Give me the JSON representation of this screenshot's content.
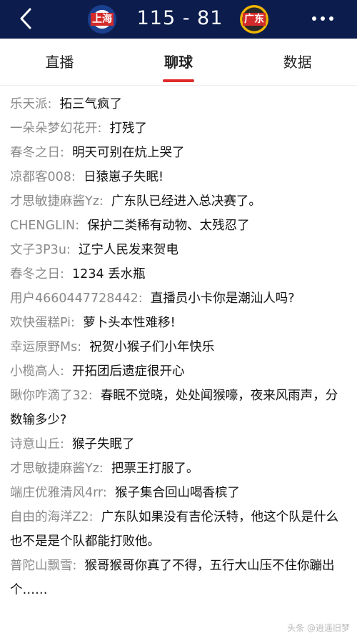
{
  "header": {
    "home_team_logo_text": "上海",
    "away_team_logo_text": "广东",
    "score": "115  -  81"
  },
  "tabs": [
    {
      "label": "直播"
    },
    {
      "label": "聊球"
    },
    {
      "label": "数据"
    }
  ],
  "messages": [
    {
      "user": "乐天派:",
      "text": "拓三气疯了"
    },
    {
      "user": "一朵朵梦幻花开:",
      "text": "打残了"
    },
    {
      "user": "春冬之日:",
      "text": "明天可别在炕上哭了"
    },
    {
      "user": "凉都客008:",
      "text": "日猿崽子失眠!"
    },
    {
      "user": "才思敏捷麻酱Yz:",
      "text": "广东队已经进入总决赛了。"
    },
    {
      "user": "CHENGLIN:",
      "text": "保护二类稀有动物、太残忍了"
    },
    {
      "user": "文子3P3u:",
      "text": "辽宁人民发来贺电"
    },
    {
      "user": "春冬之日:",
      "text": "1234  丢水瓶"
    },
    {
      "user": "用户4660447728442:",
      "text": "直播员小卡你是潮汕人吗?"
    },
    {
      "user": "欢快蛋糕Pi:",
      "text": "萝卜头本性难移!"
    },
    {
      "user": "幸运原野Ms:",
      "text": "祝贺小猴子们小年快乐"
    },
    {
      "user": "小榄高人:",
      "text": "开拓团后遗症很开心"
    },
    {
      "user": "瞅你咋滴了32:",
      "text": "春眠不觉晓，处处闻猴嚎，夜来风雨声，分数输多少?"
    },
    {
      "user": "诗意山丘:",
      "text": "猴子失眠了"
    },
    {
      "user": "才思敏捷麻酱Yz:",
      "text": "把票王打服了。"
    },
    {
      "user": "端庄优雅清风4rr:",
      "text": "猴子集合回山喝香槟了"
    },
    {
      "user": "自由的海洋Z2:",
      "text": "广东队如果没有吉伦沃特，他这个队是什么也不是是个队都能打败他。"
    },
    {
      "user": "普陀山飘雪:",
      "text": "猴哥猴哥你真了不得，五行大山压不住你蹦出个……"
    }
  ],
  "watermark": "头条 @逍遥旧梦"
}
